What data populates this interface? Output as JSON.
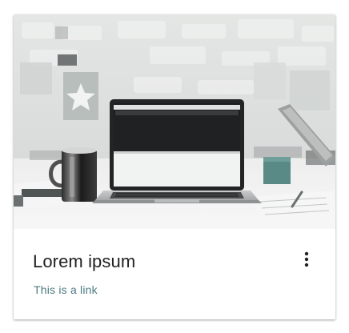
{
  "card": {
    "title": "Lorem ipsum",
    "link_text": "This is a link",
    "image_alt_icon": "laptop-desk-photo",
    "menu_icon": "more-vert-icon"
  },
  "colors": {
    "title": "#212121",
    "link": "#4d7a80",
    "card_background": "#ffffff"
  }
}
